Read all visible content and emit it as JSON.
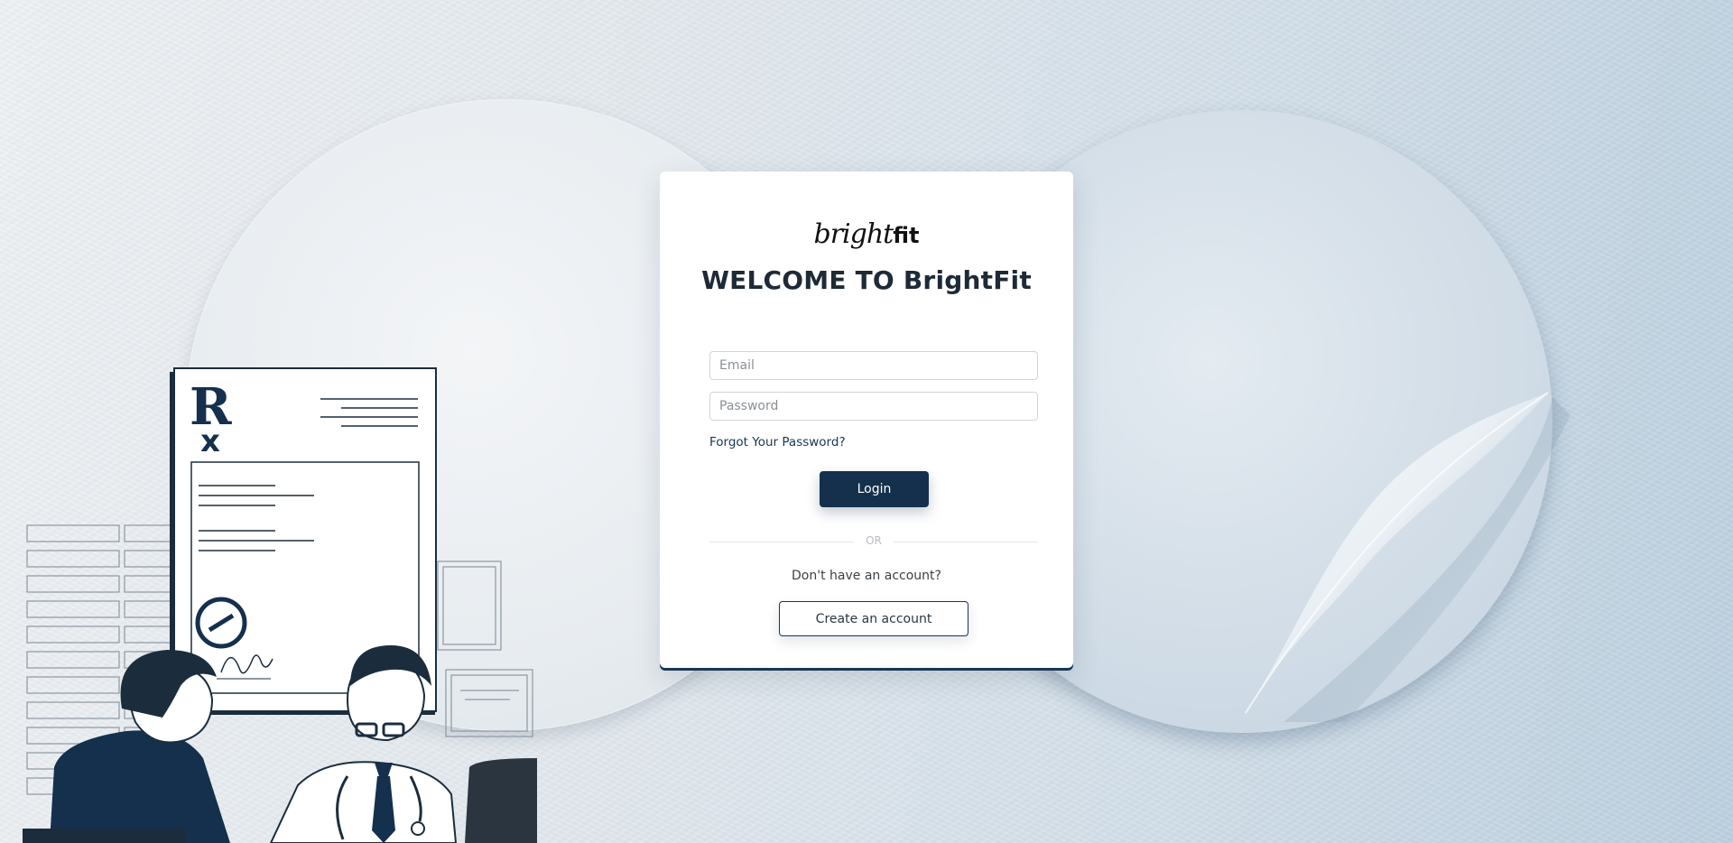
{
  "brand": {
    "logo_script": "bright",
    "logo_bold": "fit",
    "welcome_title": "WELCOME TO BrightFit"
  },
  "form": {
    "email_placeholder": "Email",
    "password_placeholder": "Password",
    "forgot_label": "Forgot Your Password?",
    "login_label": "Login",
    "divider_text": "OR",
    "no_account_text": "Don't have an account?",
    "create_account_label": "Create an account"
  },
  "illustration": {
    "rx_symbol": "R"
  },
  "colors": {
    "primary": "#15304d",
    "card": "#ffffff",
    "background": "#d4e0ea"
  }
}
